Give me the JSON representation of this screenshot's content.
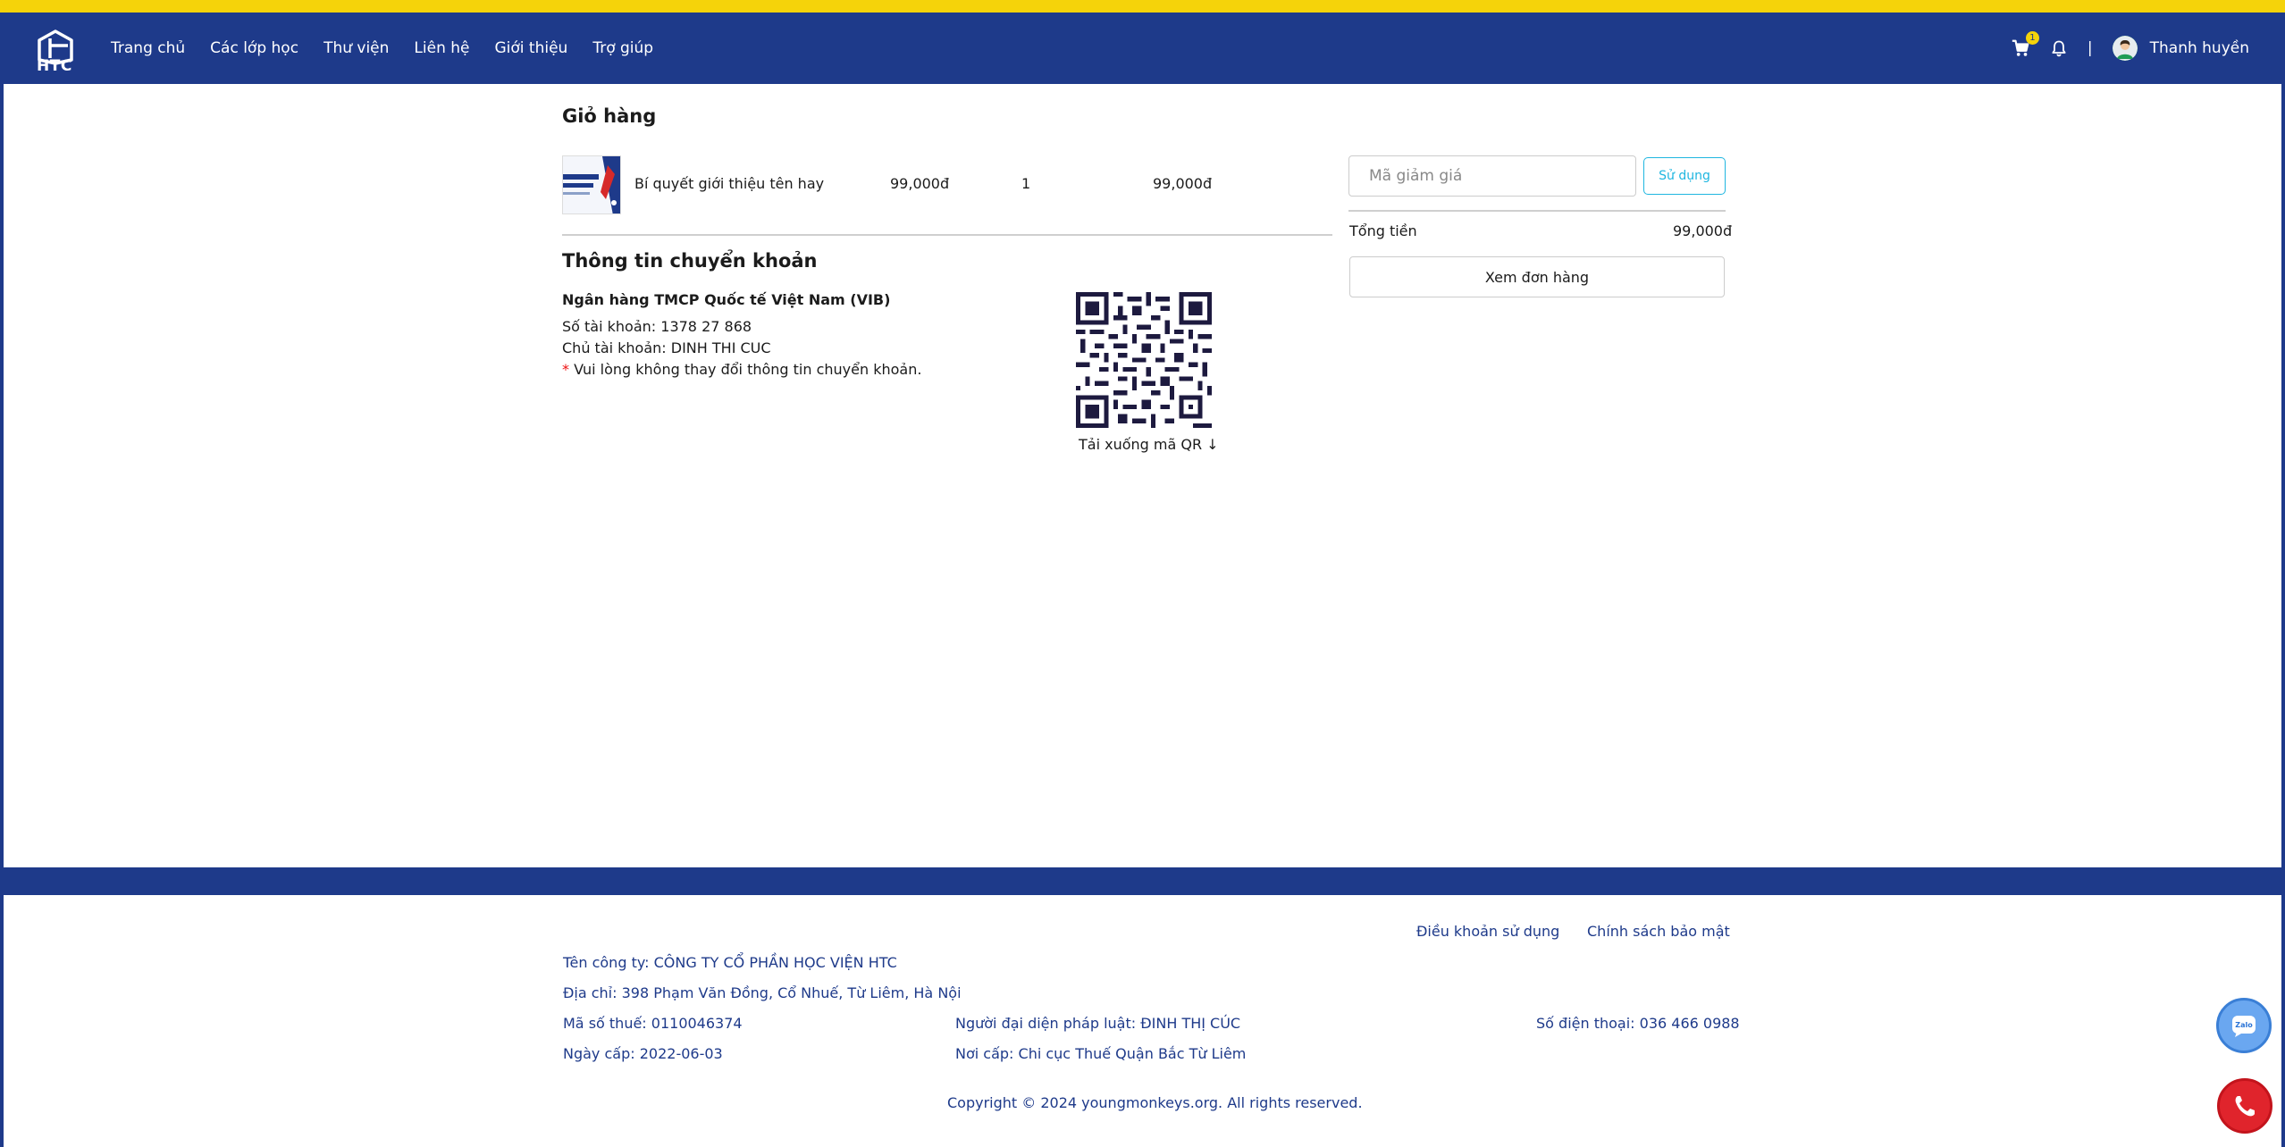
{
  "colors": {
    "accent_yellow": "#f5d30a",
    "brand_blue": "#1e3a8a",
    "link_cyan": "#1fb6e0"
  },
  "header": {
    "logo_text": "HTC",
    "nav": [
      "Trang chủ",
      "Các lớp học",
      "Thư viện",
      "Liên hệ",
      "Giới thiệu",
      "Trợ giúp"
    ],
    "cart_count": "1",
    "separator": "|",
    "user_name": "Thanh huyền"
  },
  "cart": {
    "title": "Giỏ hàng",
    "item": {
      "name": "Bí quyết giới thiệu tên hay",
      "price": "99,000đ",
      "qty": "1",
      "total": "99,000đ"
    }
  },
  "transfer": {
    "title": "Thông tin chuyển khoản",
    "bank": "Ngân hàng TMCP Quốc tế Việt Nam (VIB)",
    "account": "Số tài khoản: 1378 27 868",
    "owner": "Chủ tài khoản: DINH THI CUC",
    "note_star": "*",
    "note": "Vui lòng không thay đổi thông tin chuyển khoản.",
    "qr_download": "Tải xuống mã QR ↓"
  },
  "summary": {
    "coupon_placeholder": "Mã giảm giá",
    "use_label": "Sử dụng",
    "total_label": "Tổng tiền",
    "total_value": "99,000đ",
    "view_order": "Xem đơn hàng"
  },
  "footer": {
    "terms": "Điều khoản sử dụng",
    "privacy": "Chính sách bảo mật",
    "company": "Tên công ty: CÔNG TY CỔ PHẦN HỌC VIỆN HTC",
    "address": "Địa chỉ: 398 Phạm Văn Đồng, Cổ Nhuế, Từ Liêm, Hà Nội",
    "tax": "Mã số thuế: 0110046374",
    "rep": "Người đại diện pháp luật: ĐINH THỊ CÚC",
    "phone": "Số điện thoại: 036 466 0988",
    "issued": "Ngày cấp: 2022-06-03",
    "issued_by": "Nơi cấp: Chi cục Thuế Quận Bắc Từ Liêm",
    "copyright": "Copyright © 2024 youngmonkeys.org. All rights reserved."
  },
  "icons": [
    "cart-icon",
    "bell-icon",
    "avatar",
    "zalo-icon",
    "phone-icon"
  ]
}
